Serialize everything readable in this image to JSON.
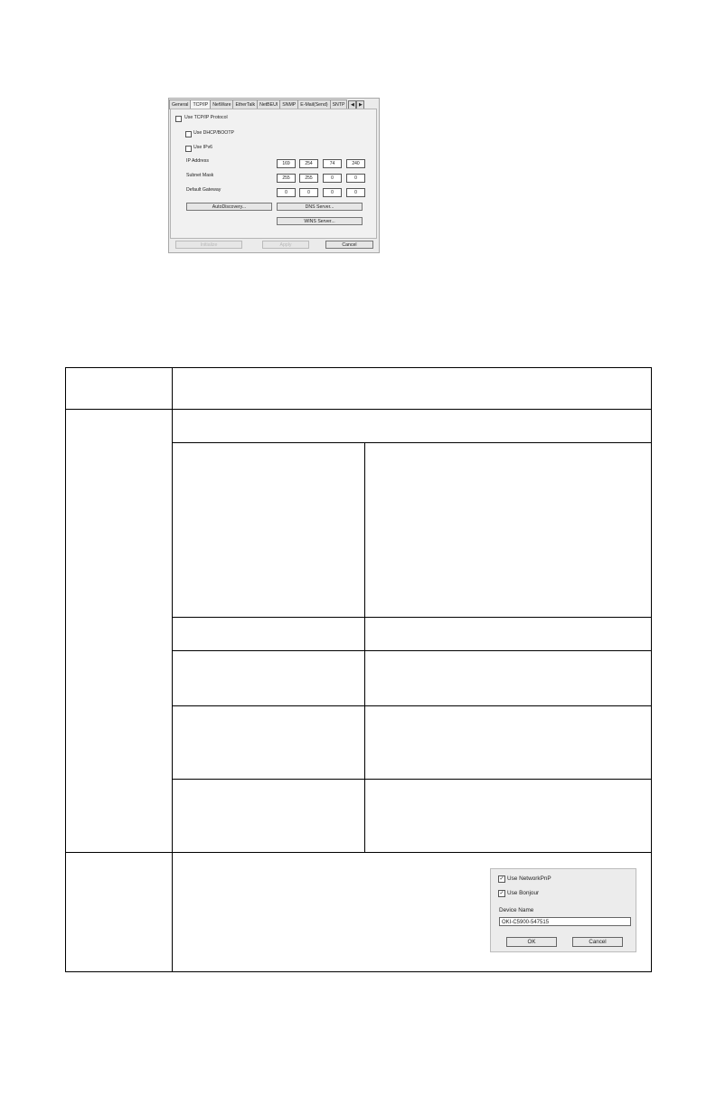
{
  "tcpip_dialog": {
    "tabs": [
      {
        "label": "General",
        "active": false
      },
      {
        "label": "TCP/IP",
        "active": true
      },
      {
        "label": "NetWare",
        "active": false
      },
      {
        "label": "EtherTalk",
        "active": false
      },
      {
        "label": "NetBEUI",
        "active": false
      },
      {
        "label": "SNMP",
        "active": false
      },
      {
        "label": "E-Mail(Send)",
        "active": false
      },
      {
        "label": "SNTP",
        "active": false
      }
    ],
    "use_tcpip_label": "Use TCP/IP Protocol",
    "use_dhcp_label": "Use DHCP/BOOTP",
    "use_ipv6_label": "Use IPv6",
    "ip_address_label": "IP Address",
    "subnet_mask_label": "Subnet Mask",
    "default_gateway_label": "Default Gateway",
    "ip_address": [
      "169",
      "254",
      "74",
      "240"
    ],
    "subnet_mask": [
      "255",
      "255",
      "0",
      "0"
    ],
    "default_gateway": [
      "0",
      "0",
      "0",
      "0"
    ],
    "autodiscovery_button": "AutoDiscovery...",
    "dns_server_button": "DNS Server...",
    "wins_server_button": "WINS Server...",
    "initialize_button": "Initialize",
    "apply_button": "Apply",
    "cancel_button": "Cancel"
  },
  "device_dialog": {
    "use_networkpnp_label": "Use NetworkPnP",
    "use_bonjour_label": "Use Bonjour",
    "device_name_label": "Device Name",
    "device_name_value": "OKI-C5900-547515",
    "ok_button": "OK",
    "cancel_button": "Cancel"
  }
}
